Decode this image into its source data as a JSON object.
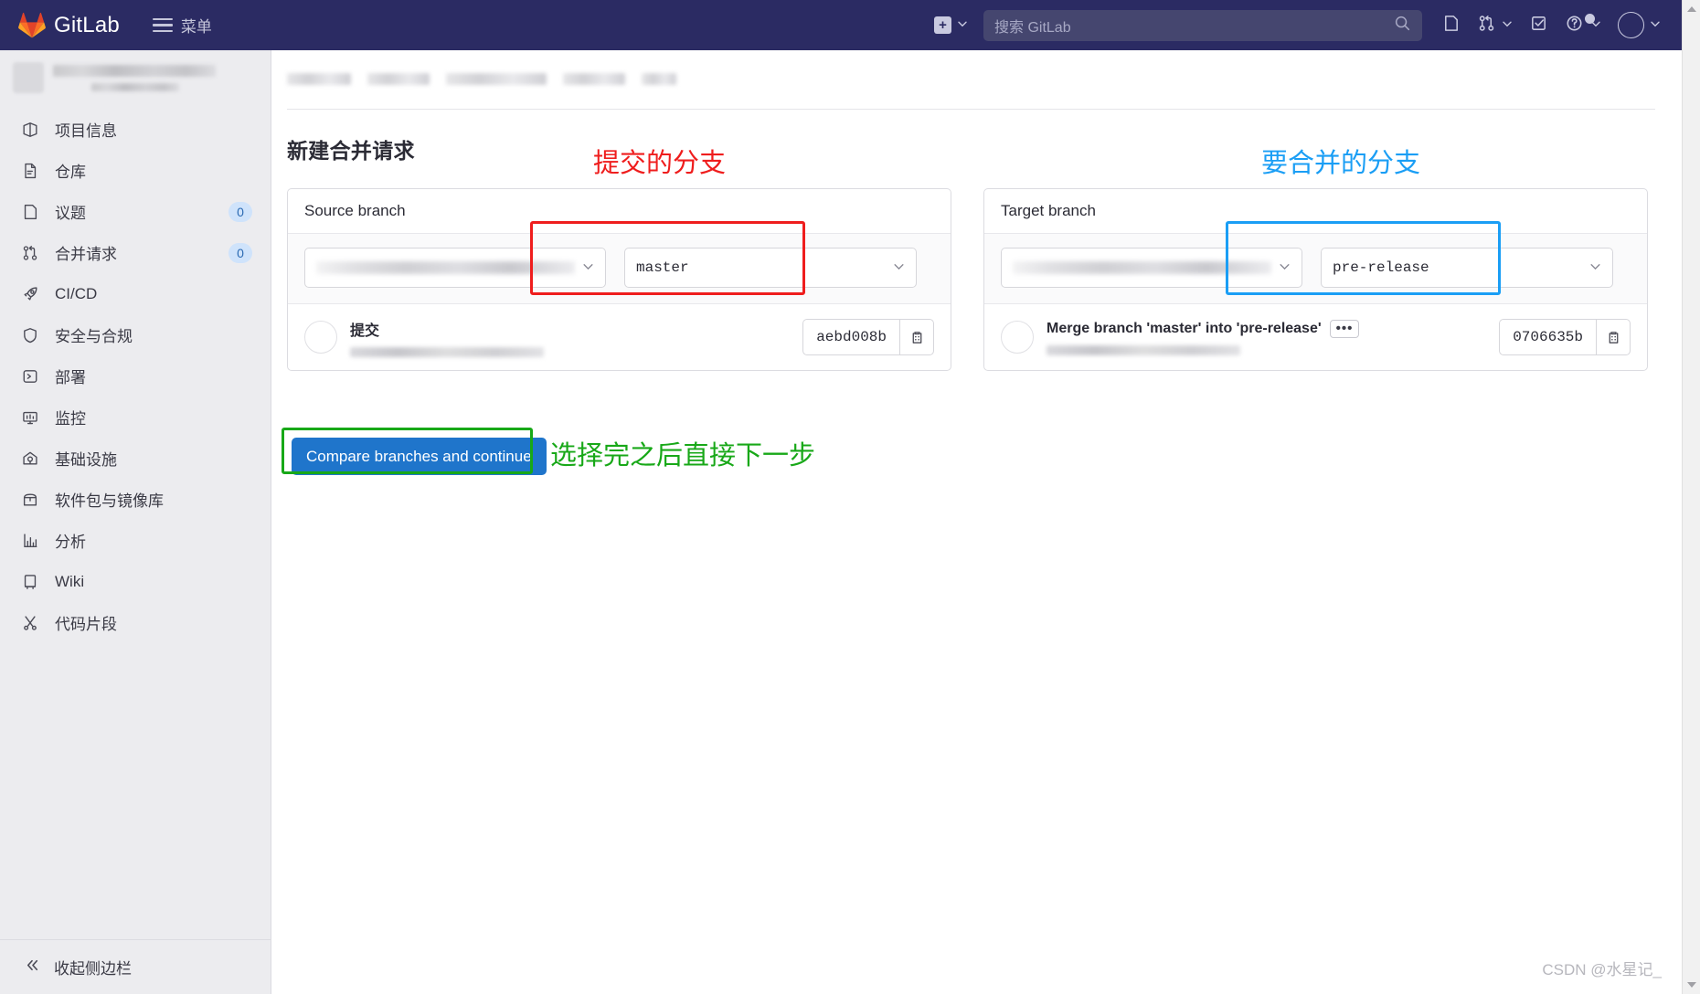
{
  "navbar": {
    "brand": "GitLab",
    "menu_label": "菜单",
    "plus_icon": "plus-square-icon",
    "search": {
      "placeholder": "搜索 GitLab",
      "value": "",
      "icon": "search-icon"
    },
    "icons": [
      {
        "name": "issues-icon",
        "glyph": "issues"
      },
      {
        "name": "merge-requests-icon",
        "glyph": "merge"
      },
      {
        "name": "todos-icon",
        "glyph": "todo"
      },
      {
        "name": "help-icon",
        "glyph": "help"
      },
      {
        "name": "user-avatar",
        "glyph": "avatar"
      }
    ],
    "bg_color": "#2b2b63"
  },
  "sidebar": {
    "project_name_redacted": true,
    "items": [
      {
        "label": "项目信息",
        "icon": "project-info-icon",
        "badge": ""
      },
      {
        "label": "仓库",
        "icon": "repository-icon",
        "badge": ""
      },
      {
        "label": "议题",
        "icon": "issues-icon",
        "badge": "0"
      },
      {
        "label": "合并请求",
        "icon": "merge-request-icon",
        "badge": "0"
      },
      {
        "label": "CI/CD",
        "icon": "rocket-icon",
        "badge": ""
      },
      {
        "label": "安全与合规",
        "icon": "shield-icon",
        "badge": ""
      },
      {
        "label": "部署",
        "icon": "deploy-icon",
        "badge": ""
      },
      {
        "label": "监控",
        "icon": "monitor-icon",
        "badge": ""
      },
      {
        "label": "基础设施",
        "icon": "infrastructure-icon",
        "badge": ""
      },
      {
        "label": "软件包与镜像库",
        "icon": "package-icon",
        "badge": ""
      },
      {
        "label": "分析",
        "icon": "analytics-icon",
        "badge": ""
      },
      {
        "label": "Wiki",
        "icon": "wiki-icon",
        "badge": ""
      },
      {
        "label": "代码片段",
        "icon": "snippet-icon",
        "badge": ""
      }
    ],
    "collapse_label": "收起侧边栏",
    "collapse_icon": "chevron-double-left-icon"
  },
  "main": {
    "page_title": "新建合并请求",
    "source_card": {
      "heading": "Source branch",
      "project_select_value": "",
      "branch_select_value": "master",
      "commit": {
        "title": "提交",
        "sha": "aebd008b",
        "copy_icon": "copy-to-clipboard-icon",
        "has_ellipsis": false,
        "ellipsis_label": ""
      }
    },
    "target_card": {
      "heading": "Target branch",
      "project_select_value": "",
      "branch_select_value": "pre-release",
      "commit": {
        "title": "Merge branch 'master' into 'pre-release'",
        "sha": "0706635b",
        "copy_icon": "copy-to-clipboard-icon",
        "has_ellipsis": true,
        "ellipsis_label": "•••"
      }
    },
    "compare_button": "Compare branches and continue"
  },
  "annotations": [
    {
      "id": "source-note",
      "text": "提交的分支",
      "color": "#ef1d1d"
    },
    {
      "id": "target-note",
      "text": "要合并的分支",
      "color": "#1a9ef5"
    },
    {
      "id": "button-note",
      "text": "选择完之后直接下一步",
      "color": "#18a818"
    }
  ],
  "watermark": "CSDN @水星记_"
}
